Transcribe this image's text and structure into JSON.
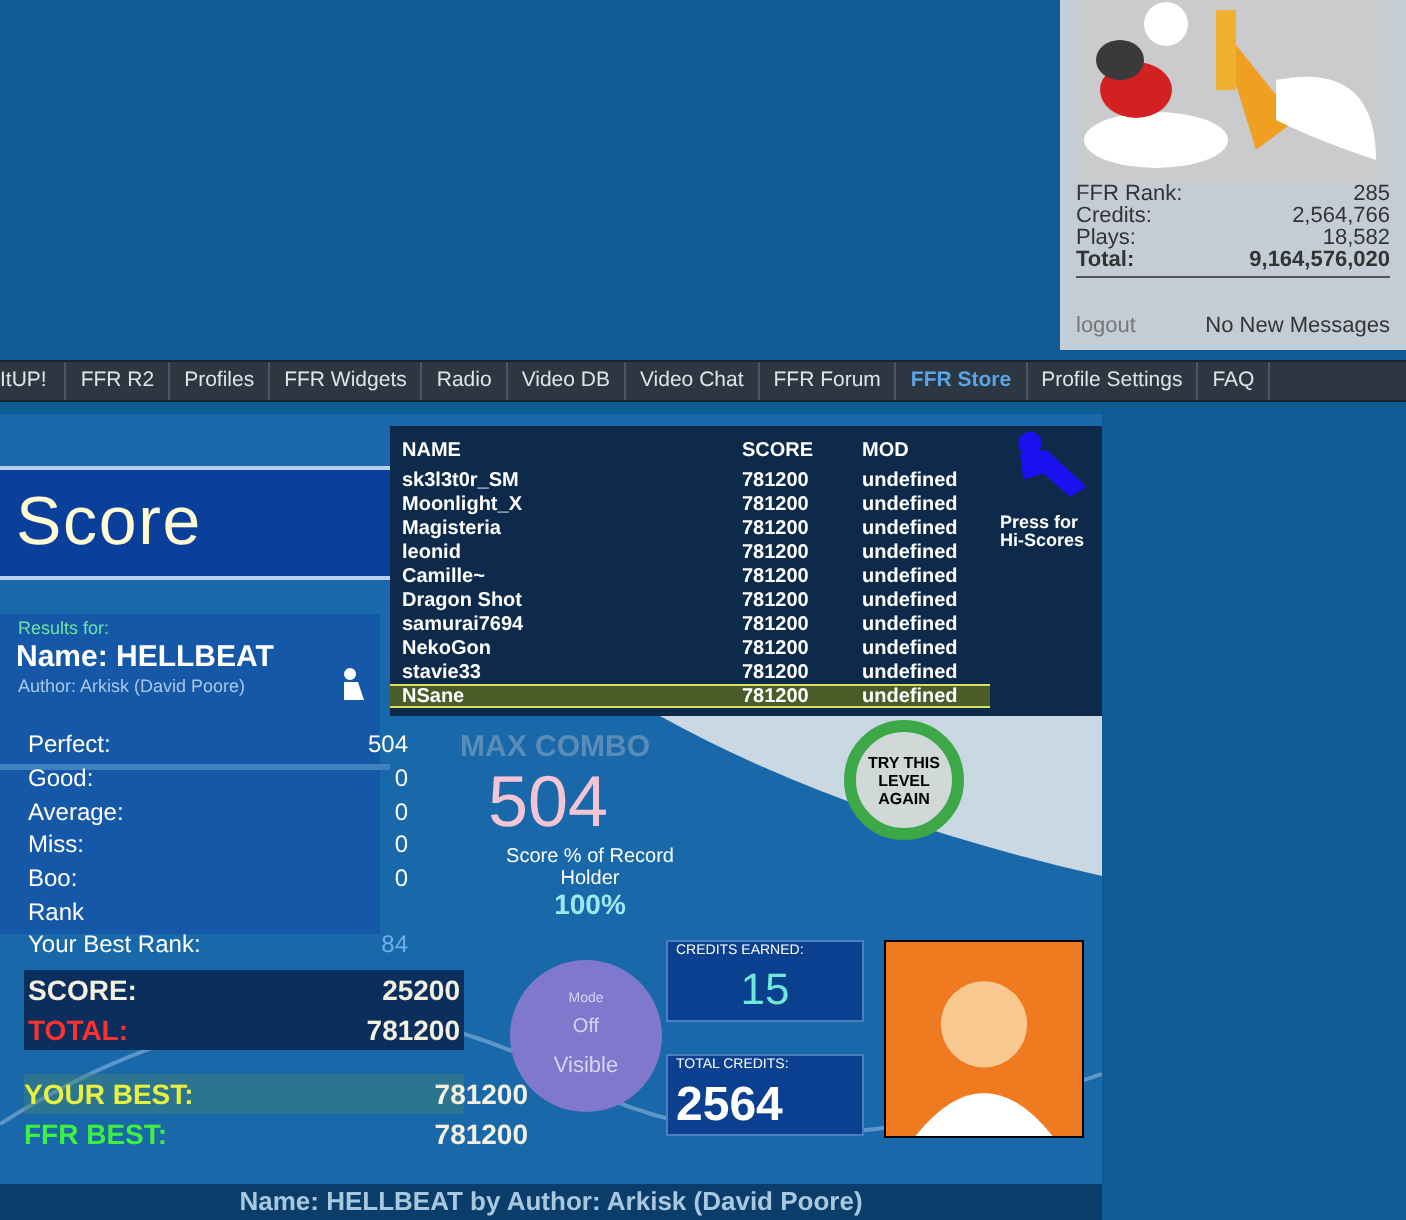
{
  "user_panel": {
    "stats": [
      {
        "label": "FFR Rank:",
        "value": "285",
        "kind": "normal"
      },
      {
        "label": "Credits:",
        "value": "2,564,766",
        "kind": "normal"
      },
      {
        "label": "Plays:",
        "value": "18,582",
        "kind": "normal"
      },
      {
        "label": "Total:",
        "value": "9,164,576,020",
        "kind": "total"
      }
    ],
    "logout": "logout",
    "messages": "No New Messages"
  },
  "nav": [
    {
      "label": "ItUP!",
      "selected": false
    },
    {
      "label": "FFR R2",
      "selected": false
    },
    {
      "label": "Profiles",
      "selected": false
    },
    {
      "label": "FFR Widgets",
      "selected": false
    },
    {
      "label": "Radio",
      "selected": false
    },
    {
      "label": "Video DB",
      "selected": false
    },
    {
      "label": "Video Chat",
      "selected": false
    },
    {
      "label": "FFR Forum",
      "selected": false
    },
    {
      "label": "FFR Store",
      "selected": true
    },
    {
      "label": "Profile Settings",
      "selected": false
    },
    {
      "label": "FAQ",
      "selected": false
    }
  ],
  "game": {
    "title": "Score",
    "results_for": "Results for:",
    "song_name": "Name: HELLBEAT",
    "author": "Author: Arkisk (David Poore)",
    "judgements": [
      {
        "label": "Perfect:",
        "value": "504"
      },
      {
        "label": "Good:",
        "value": "0"
      },
      {
        "label": "Average:",
        "value": "0"
      },
      {
        "label": "Miss:",
        "value": "0"
      },
      {
        "label": "Boo:",
        "value": "0"
      },
      {
        "label": "Rank"
      },
      {
        "label": "Your Best Rank:",
        "value": "84"
      }
    ],
    "max_combo_label": "MAX COMBO",
    "max_combo": "504",
    "record_label": "Score % of Record Holder",
    "record_percent": "100%",
    "totals": [
      {
        "label": "SCORE:",
        "value": "25200",
        "kind": "score"
      },
      {
        "label": "TOTAL:",
        "value": "781200",
        "kind": "total"
      },
      {
        "label": "YOUR BEST:",
        "value": "781200",
        "kind": "best"
      },
      {
        "label": "FFR BEST:",
        "value": "781200",
        "kind": "ffr"
      }
    ],
    "mode": {
      "label": "Mode",
      "state": "Off",
      "visibility": "Visible"
    },
    "credits_earned": {
      "label": "CREDITS EARNED:",
      "value": "15"
    },
    "total_credits": {
      "label": "TOTAL CREDITS:",
      "value": "2564"
    },
    "try_again": "TRY THIS LEVEL AGAIN",
    "footer": "Name: HELLBEAT by Author: Arkisk (David Poore)",
    "hi_scores_hint": "Press for Hi-Scores"
  },
  "leaderboard": {
    "columns": [
      "NAME",
      "SCORE",
      "MOD"
    ],
    "rows": [
      {
        "name": "sk3l3t0r_SM",
        "score": "781200",
        "mod": "undefined",
        "selected": false
      },
      {
        "name": "Moonlight_X",
        "score": "781200",
        "mod": "undefined",
        "selected": false
      },
      {
        "name": "Magisteria",
        "score": "781200",
        "mod": "undefined",
        "selected": false
      },
      {
        "name": "leonid",
        "score": "781200",
        "mod": "undefined",
        "selected": false
      },
      {
        "name": "Camille~",
        "score": "781200",
        "mod": "undefined",
        "selected": false
      },
      {
        "name": "Dragon Shot",
        "score": "781200",
        "mod": "undefined",
        "selected": false
      },
      {
        "name": "samurai7694",
        "score": "781200",
        "mod": "undefined",
        "selected": false
      },
      {
        "name": "NekoGon",
        "score": "781200",
        "mod": "undefined",
        "selected": false
      },
      {
        "name": "stavie33",
        "score": "781200",
        "mod": "undefined",
        "selected": false
      },
      {
        "name": "NSane",
        "score": "781200",
        "mod": "undefined",
        "selected": true
      }
    ]
  }
}
